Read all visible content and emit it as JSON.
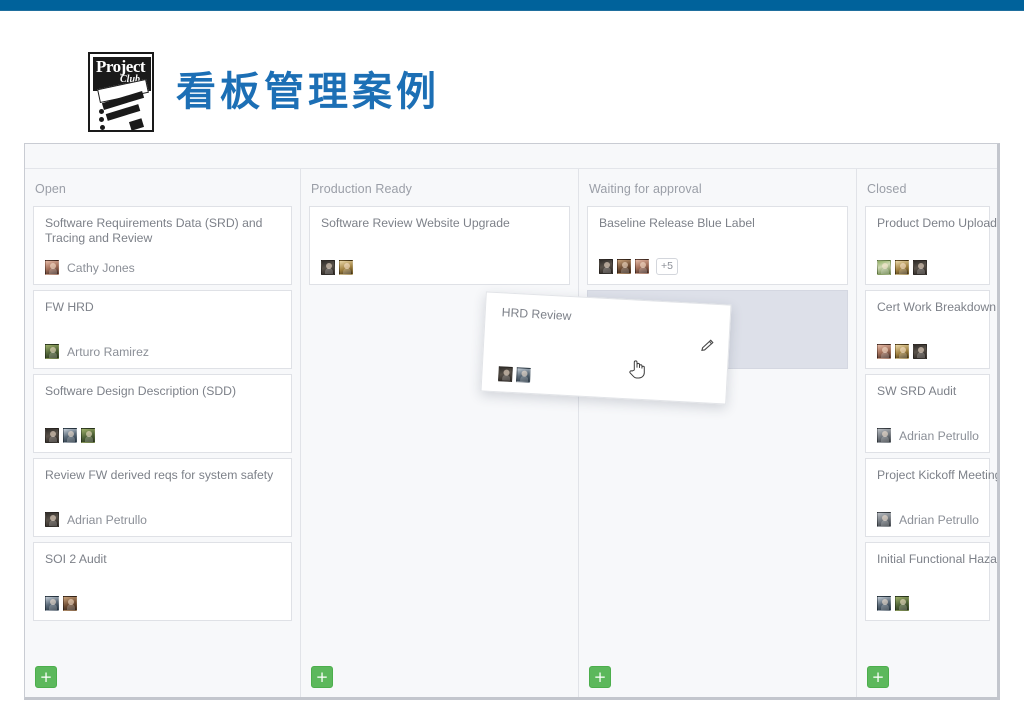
{
  "topbar": {
    "color": "#00629b"
  },
  "header": {
    "title": "看板管理案例",
    "logo_primary": "Project",
    "logo_secondary": "Club",
    "title_color": "#1c6fb5"
  },
  "board": {
    "columns": [
      {
        "title": "Open",
        "add_label": "+",
        "cards": [
          {
            "title": "Software Requirements Data (SRD) and Tracing and Review",
            "assignee": "Cathy Jones",
            "avatars": [
              "a-rose"
            ],
            "extra": ""
          },
          {
            "title": "FW HRD",
            "assignee": "Arturo Ramirez",
            "avatars": [
              "a-green"
            ],
            "extra": ""
          },
          {
            "title": "Software Design Description (SDD)",
            "assignee": "",
            "avatars": [
              "a-dark",
              "a-blue",
              "a-green"
            ],
            "extra": ""
          },
          {
            "title": "Review FW derived reqs for system safety",
            "assignee": "Adrian Petrullo",
            "avatars": [
              "a-dark"
            ],
            "extra": ""
          },
          {
            "title": "SOI 2 Audit",
            "assignee": "",
            "avatars": [
              "a-blue",
              "a-warm"
            ],
            "extra": ""
          }
        ]
      },
      {
        "title": "Production Ready",
        "add_label": "+",
        "cards": [
          {
            "title": "Software Review Website Upgrade",
            "assignee": "",
            "avatars": [
              "a-dark",
              "a-gold"
            ],
            "extra": ""
          }
        ]
      },
      {
        "title": "Waiting for approval",
        "add_label": "+",
        "cards": [
          {
            "title": "Baseline Release Blue Label",
            "assignee": "",
            "avatars": [
              "a-dark",
              "a-warm",
              "a-rose"
            ],
            "extra": "+5"
          }
        ],
        "has_placeholder": true
      },
      {
        "title": "Closed",
        "add_label": "+",
        "cards": [
          {
            "title": "Product Demo Upload",
            "assignee": "",
            "avatars": [
              "a-photo",
              "a-gold",
              "a-dark"
            ],
            "extra": ""
          },
          {
            "title": "Cert Work Breakdown Stru",
            "assignee": "",
            "avatars": [
              "a-rose",
              "a-gold",
              "a-dark"
            ],
            "extra": ""
          },
          {
            "title": "SW SRD Audit",
            "assignee": "Adrian Petrullo",
            "avatars": [
              "a-grey"
            ],
            "extra": ""
          },
          {
            "title": "Project Kickoff Meeting - In",
            "assignee": "Adrian Petrullo",
            "avatars": [
              "a-grey"
            ],
            "extra": ""
          },
          {
            "title": "Initial Functional Hazard A",
            "assignee": "",
            "avatars": [
              "a-blue",
              "a-green"
            ],
            "extra": ""
          }
        ]
      }
    ]
  },
  "drag_card": {
    "title": "HRD Review",
    "avatars": [
      "a-dark",
      "a-blue"
    ],
    "edit_icon": "pencil-icon"
  },
  "cursor": {
    "icon": "pointing-hand-cursor"
  }
}
